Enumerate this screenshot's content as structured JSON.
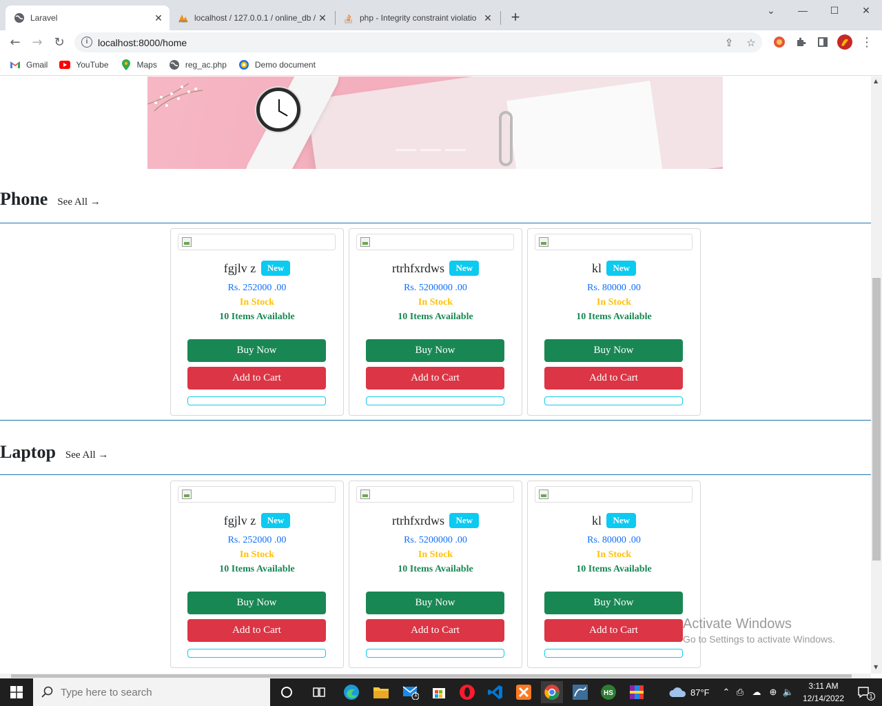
{
  "browser": {
    "tabs": [
      {
        "title": "Laravel",
        "active": true
      },
      {
        "title": "localhost / 127.0.0.1 / online_db /",
        "active": false
      },
      {
        "title": "php - Integrity constraint violatio",
        "active": false
      }
    ],
    "url": "localhost:8000/home",
    "bookmarks": [
      {
        "label": "Gmail",
        "icon": "gmail-icon"
      },
      {
        "label": "YouTube",
        "icon": "youtube-icon"
      },
      {
        "label": "Maps",
        "icon": "maps-icon"
      },
      {
        "label": "reg_ac.php",
        "icon": "globe-icon"
      },
      {
        "label": "Demo document",
        "icon": "document-icon"
      }
    ]
  },
  "sections": [
    {
      "title": "Phone",
      "see_all": "See All →",
      "products": [
        {
          "name": "fgjlv z",
          "badge": "New",
          "price": "Rs. 252000 .00",
          "stock": "In Stock",
          "available": "10 Items Available",
          "buy": "Buy Now",
          "cart": "Add to Cart"
        },
        {
          "name": "rtrhfxrdws",
          "badge": "New",
          "price": "Rs. 5200000 .00",
          "stock": "In Stock",
          "available": "10 Items Available",
          "buy": "Buy Now",
          "cart": "Add to Cart"
        },
        {
          "name": "kl",
          "badge": "New",
          "price": "Rs. 80000 .00",
          "stock": "In Stock",
          "available": "10 Items Available",
          "buy": "Buy Now",
          "cart": "Add to Cart"
        }
      ]
    },
    {
      "title": "Laptop",
      "see_all": "See All →",
      "products": [
        {
          "name": "fgjlv z",
          "badge": "New",
          "price": "Rs. 252000 .00",
          "stock": "In Stock",
          "available": "10 Items Available",
          "buy": "Buy Now",
          "cart": "Add to Cart"
        },
        {
          "name": "rtrhfxrdws",
          "badge": "New",
          "price": "Rs. 5200000 .00",
          "stock": "In Stock",
          "available": "10 Items Available",
          "buy": "Buy Now",
          "cart": "Add to Cart"
        },
        {
          "name": "kl",
          "badge": "New",
          "price": "Rs. 80000 .00",
          "stock": "In Stock",
          "available": "10 Items Available",
          "buy": "Buy Now",
          "cart": "Add to Cart"
        }
      ]
    }
  ],
  "watermark": {
    "line1": "Activate Windows",
    "line2": "Go to Settings to activate Windows."
  },
  "taskbar": {
    "search_placeholder": "Type here to search",
    "weather": "87°F",
    "time": "3:11 AM",
    "date": "12/14/2022",
    "notification_count": "1",
    "mail_badge": "1"
  },
  "colors": {
    "buy": "#198754",
    "cart": "#dc3545",
    "badge": "#0dcaf0",
    "price": "#0d6efd",
    "stock": "#ffc107",
    "divider": "#1d73b2"
  }
}
